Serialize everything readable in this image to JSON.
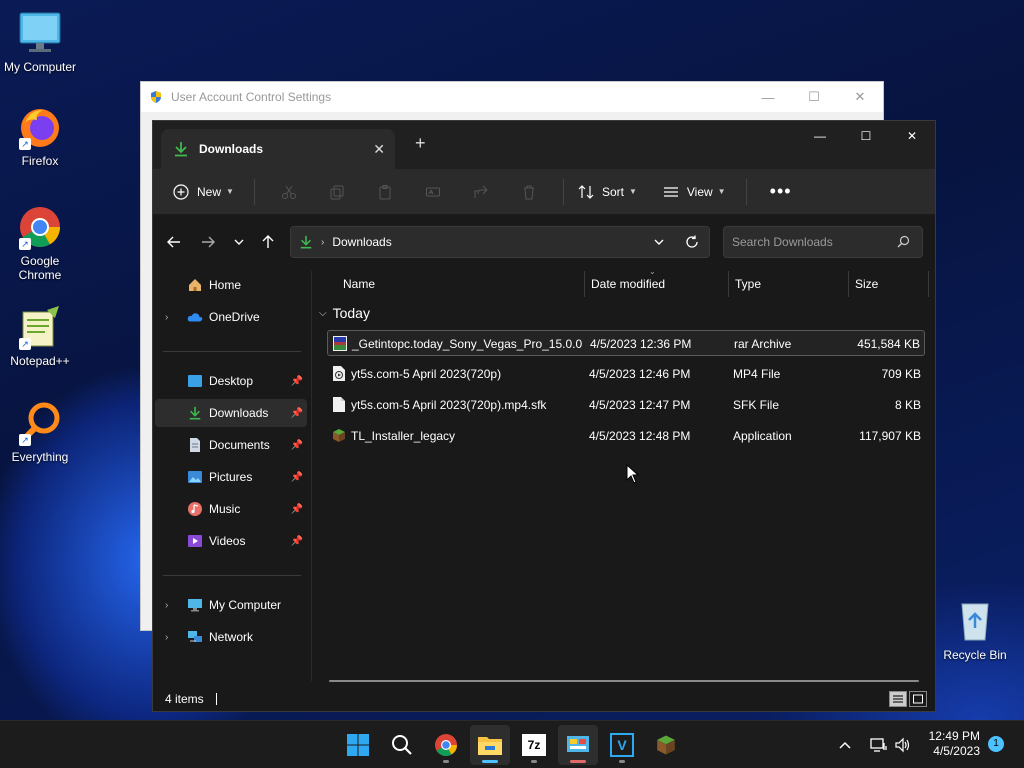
{
  "desktop": {
    "icons": [
      {
        "label": "My Computer"
      },
      {
        "label": "Firefox"
      },
      {
        "label": "Google\nChrome"
      },
      {
        "label": "Notepad++"
      },
      {
        "label": "Everything"
      },
      {
        "label": "Recycle Bin"
      }
    ]
  },
  "uac": {
    "title": "User Account Control Settings"
  },
  "explorer": {
    "tab_label": "Downloads",
    "toolbar": {
      "new_label": "New",
      "sort_label": "Sort",
      "view_label": "View"
    },
    "address": {
      "path": "Downloads",
      "search_placeholder": "Search Downloads"
    },
    "sidebar": {
      "home": "Home",
      "onedrive": "OneDrive",
      "desktop": "Desktop",
      "downloads": "Downloads",
      "documents": "Documents",
      "pictures": "Pictures",
      "music": "Music",
      "videos": "Videos",
      "my_computer": "My Computer",
      "network": "Network"
    },
    "columns": {
      "name": "Name",
      "date": "Date modified",
      "type": "Type",
      "size": "Size"
    },
    "group": "Today",
    "files": [
      {
        "name": "_Getintopc.today_Sony_Vegas_Pro_15.0.0",
        "date": "4/5/2023 12:36 PM",
        "type": "rar Archive",
        "size": "451,584 KB"
      },
      {
        "name": "yt5s.com-5 April 2023(720p)",
        "date": "4/5/2023 12:46 PM",
        "type": "MP4 File",
        "size": "709 KB"
      },
      {
        "name": "yt5s.com-5 April 2023(720p).mp4.sfk",
        "date": "4/5/2023 12:47 PM",
        "type": "SFK File",
        "size": "8 KB"
      },
      {
        "name": "TL_Installer_legacy",
        "date": "4/5/2023 12:48 PM",
        "type": "Application",
        "size": "117,907 KB"
      }
    ],
    "status": "4 items"
  },
  "taskbar": {
    "time": "12:49 PM",
    "date": "4/5/2023",
    "notification_count": "1",
    "app_7z": "7z",
    "app_v": "V"
  },
  "colors": {
    "accent": "#4cc2ff",
    "window_bg": "#191919",
    "download_green": "#3fb950"
  }
}
